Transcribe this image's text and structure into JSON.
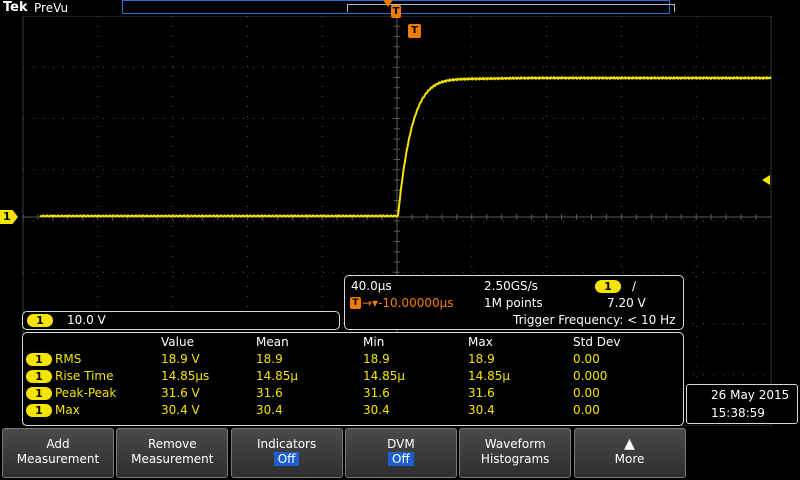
{
  "header": {
    "logo": "Tek",
    "status": "PreVu"
  },
  "markers": {
    "trigger_glyph": "T",
    "channel": "1"
  },
  "timebase": {
    "scale": "40.0µs",
    "sample_rate": "2.50GS/s",
    "trigger_channel": "1",
    "trigger_slope_icon": "rising-edge-icon",
    "trigger_slope": "∕",
    "trigger_delay": "→▾-10.00000µs",
    "record_length": "1M points",
    "trigger_level": "7.20 V",
    "trigger_frequency": "Trigger Frequency: < 10 Hz"
  },
  "channel_readout": {
    "channel": "1",
    "scale": "10.0 V"
  },
  "measurements": {
    "headers": [
      "Value",
      "Mean",
      "Min",
      "Max",
      "Std Dev"
    ],
    "rows": [
      {
        "channel": "1",
        "name": "RMS",
        "value": "18.9 V",
        "mean": "18.9",
        "min": "18.9",
        "max": "18.9",
        "std": "0.00"
      },
      {
        "channel": "1",
        "name": "Rise Time",
        "value": "14.85µs",
        "mean": "14.85µ",
        "min": "14.85µ",
        "max": "14.85µ",
        "std": "0.000"
      },
      {
        "channel": "1",
        "name": "Peak-Peak",
        "value": "31.6 V",
        "mean": "31.6",
        "min": "31.6",
        "max": "31.6",
        "std": "0.00"
      },
      {
        "channel": "1",
        "name": "Max",
        "value": "30.4 V",
        "mean": "30.4",
        "min": "30.4",
        "max": "30.4",
        "std": "0.00"
      }
    ]
  },
  "datetime": {
    "date": "26 May  2015",
    "time": "15:38:59"
  },
  "menu": [
    {
      "line1": "Add",
      "line2": "Measurement",
      "state": ""
    },
    {
      "line1": "Remove",
      "line2": "Measurement",
      "state": ""
    },
    {
      "line1": "Indicators",
      "line2": "",
      "state": "Off"
    },
    {
      "line1": "DVM",
      "line2": "",
      "state": "Off"
    },
    {
      "line1": "Waveform",
      "line2": "Histograms",
      "state": ""
    },
    {
      "line1": "▲",
      "line2": "More",
      "state": ""
    }
  ],
  "colors": {
    "channel1": "#f5e400",
    "trigger": "#f07d00",
    "state_badge": "#1c5fd0"
  }
}
